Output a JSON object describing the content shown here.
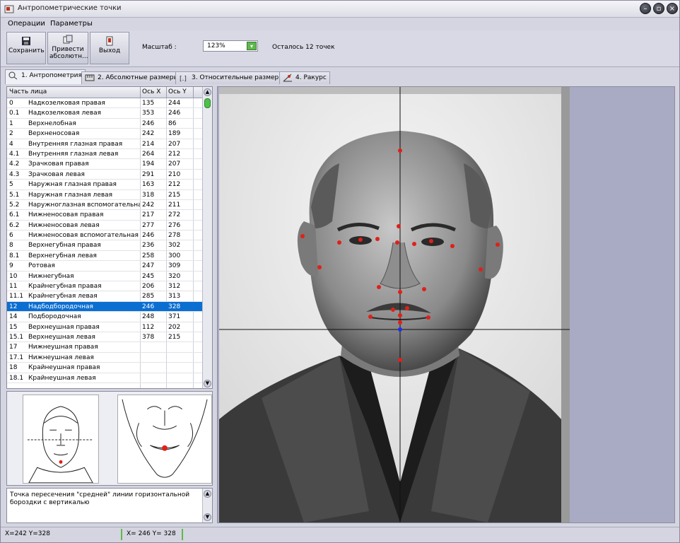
{
  "window": {
    "title": "Антропометрические точки"
  },
  "menu": {
    "items": [
      "Операции",
      "Параметры"
    ]
  },
  "toolbar": {
    "save_label": "Сохранить",
    "absolute_label": "Привести абсолютн...",
    "exit_label": "Выход",
    "scale_label": "Масштаб :",
    "scale_value": "123%",
    "remaining": "Осталось 12 точек"
  },
  "tabs": [
    {
      "label": "1. Антропометрия",
      "active": true
    },
    {
      "label": "2. Абсолютные размеры",
      "active": false
    },
    {
      "label": "3. Относительные размеры",
      "active": false
    },
    {
      "label": "4. Ракурс",
      "active": false
    }
  ],
  "table": {
    "headers": [
      "Часть лица",
      "Ось X",
      "Ось Y"
    ],
    "rows": [
      {
        "id": "0",
        "name": "Надкозелковая правая",
        "x": "135",
        "y": "244"
      },
      {
        "id": "0.1",
        "name": "Надкозелковая левая",
        "x": "353",
        "y": "246"
      },
      {
        "id": "1",
        "name": "Верхнелобная",
        "x": "246",
        "y": "86"
      },
      {
        "id": "2",
        "name": "Верхненосовая",
        "x": "242",
        "y": "189"
      },
      {
        "id": "4",
        "name": "Внутренняя глазная правая",
        "x": "214",
        "y": "207"
      },
      {
        "id": "4.1",
        "name": "Внутренняя глазная левая",
        "x": "264",
        "y": "212"
      },
      {
        "id": "4.2",
        "name": "Зрачковая правая",
        "x": "194",
        "y": "207"
      },
      {
        "id": "4.3",
        "name": "Зрачковая левая",
        "x": "291",
        "y": "210"
      },
      {
        "id": "5",
        "name": "Наружная глазная правая",
        "x": "163",
        "y": "212"
      },
      {
        "id": "5.1",
        "name": "Наружная глазная левая",
        "x": "318",
        "y": "215"
      },
      {
        "id": "5.2",
        "name": "Наружноглазная вспомогательная",
        "x": "242",
        "y": "211"
      },
      {
        "id": "6.1",
        "name": "Нижненосовая правая",
        "x": "217",
        "y": "272"
      },
      {
        "id": "6.2",
        "name": "Нижненосовая левая",
        "x": "277",
        "y": "276"
      },
      {
        "id": "6",
        "name": "Нижненосовая вспомогательная",
        "x": "246",
        "y": "278"
      },
      {
        "id": "8",
        "name": "Верхнегубная правая",
        "x": "236",
        "y": "302"
      },
      {
        "id": "8.1",
        "name": "Верхнегубная левая",
        "x": "258",
        "y": "300"
      },
      {
        "id": "9",
        "name": "Ротовая",
        "x": "247",
        "y": "309"
      },
      {
        "id": "10",
        "name": "Нижнегубная",
        "x": "245",
        "y": "320"
      },
      {
        "id": "11",
        "name": "Крайнегубная правая",
        "x": "206",
        "y": "312"
      },
      {
        "id": "11.1",
        "name": "Крайнегубная левая",
        "x": "285",
        "y": "313"
      },
      {
        "id": "12",
        "name": "Надбодбородочная",
        "x": "246",
        "y": "328",
        "selected": true
      },
      {
        "id": "14",
        "name": "Подбородочная",
        "x": "248",
        "y": "371"
      },
      {
        "id": "15",
        "name": "Верхнеушная правая",
        "x": "112",
        "y": "202"
      },
      {
        "id": "15.1",
        "name": "Верхнеушная левая",
        "x": "378",
        "y": "215"
      },
      {
        "id": "17",
        "name": "Нижнеушная правая",
        "x": "",
        "y": ""
      },
      {
        "id": "17.1",
        "name": "Нижнеушная левая",
        "x": "",
        "y": ""
      },
      {
        "id": "18",
        "name": "Крайнеушная правая",
        "x": "",
        "y": ""
      },
      {
        "id": "18.1",
        "name": "Крайнеушная левая",
        "x": "",
        "y": ""
      }
    ]
  },
  "description": "Точка пересечения \"средней\" линии горизонтальной бороздки с вертикалью",
  "status": {
    "left": "X=242 Y=328",
    "right": "X= 246  Y= 328"
  },
  "colors": {
    "selection": "#0b6fd1",
    "point": "#e0201a",
    "accent": "#5fb84d"
  }
}
